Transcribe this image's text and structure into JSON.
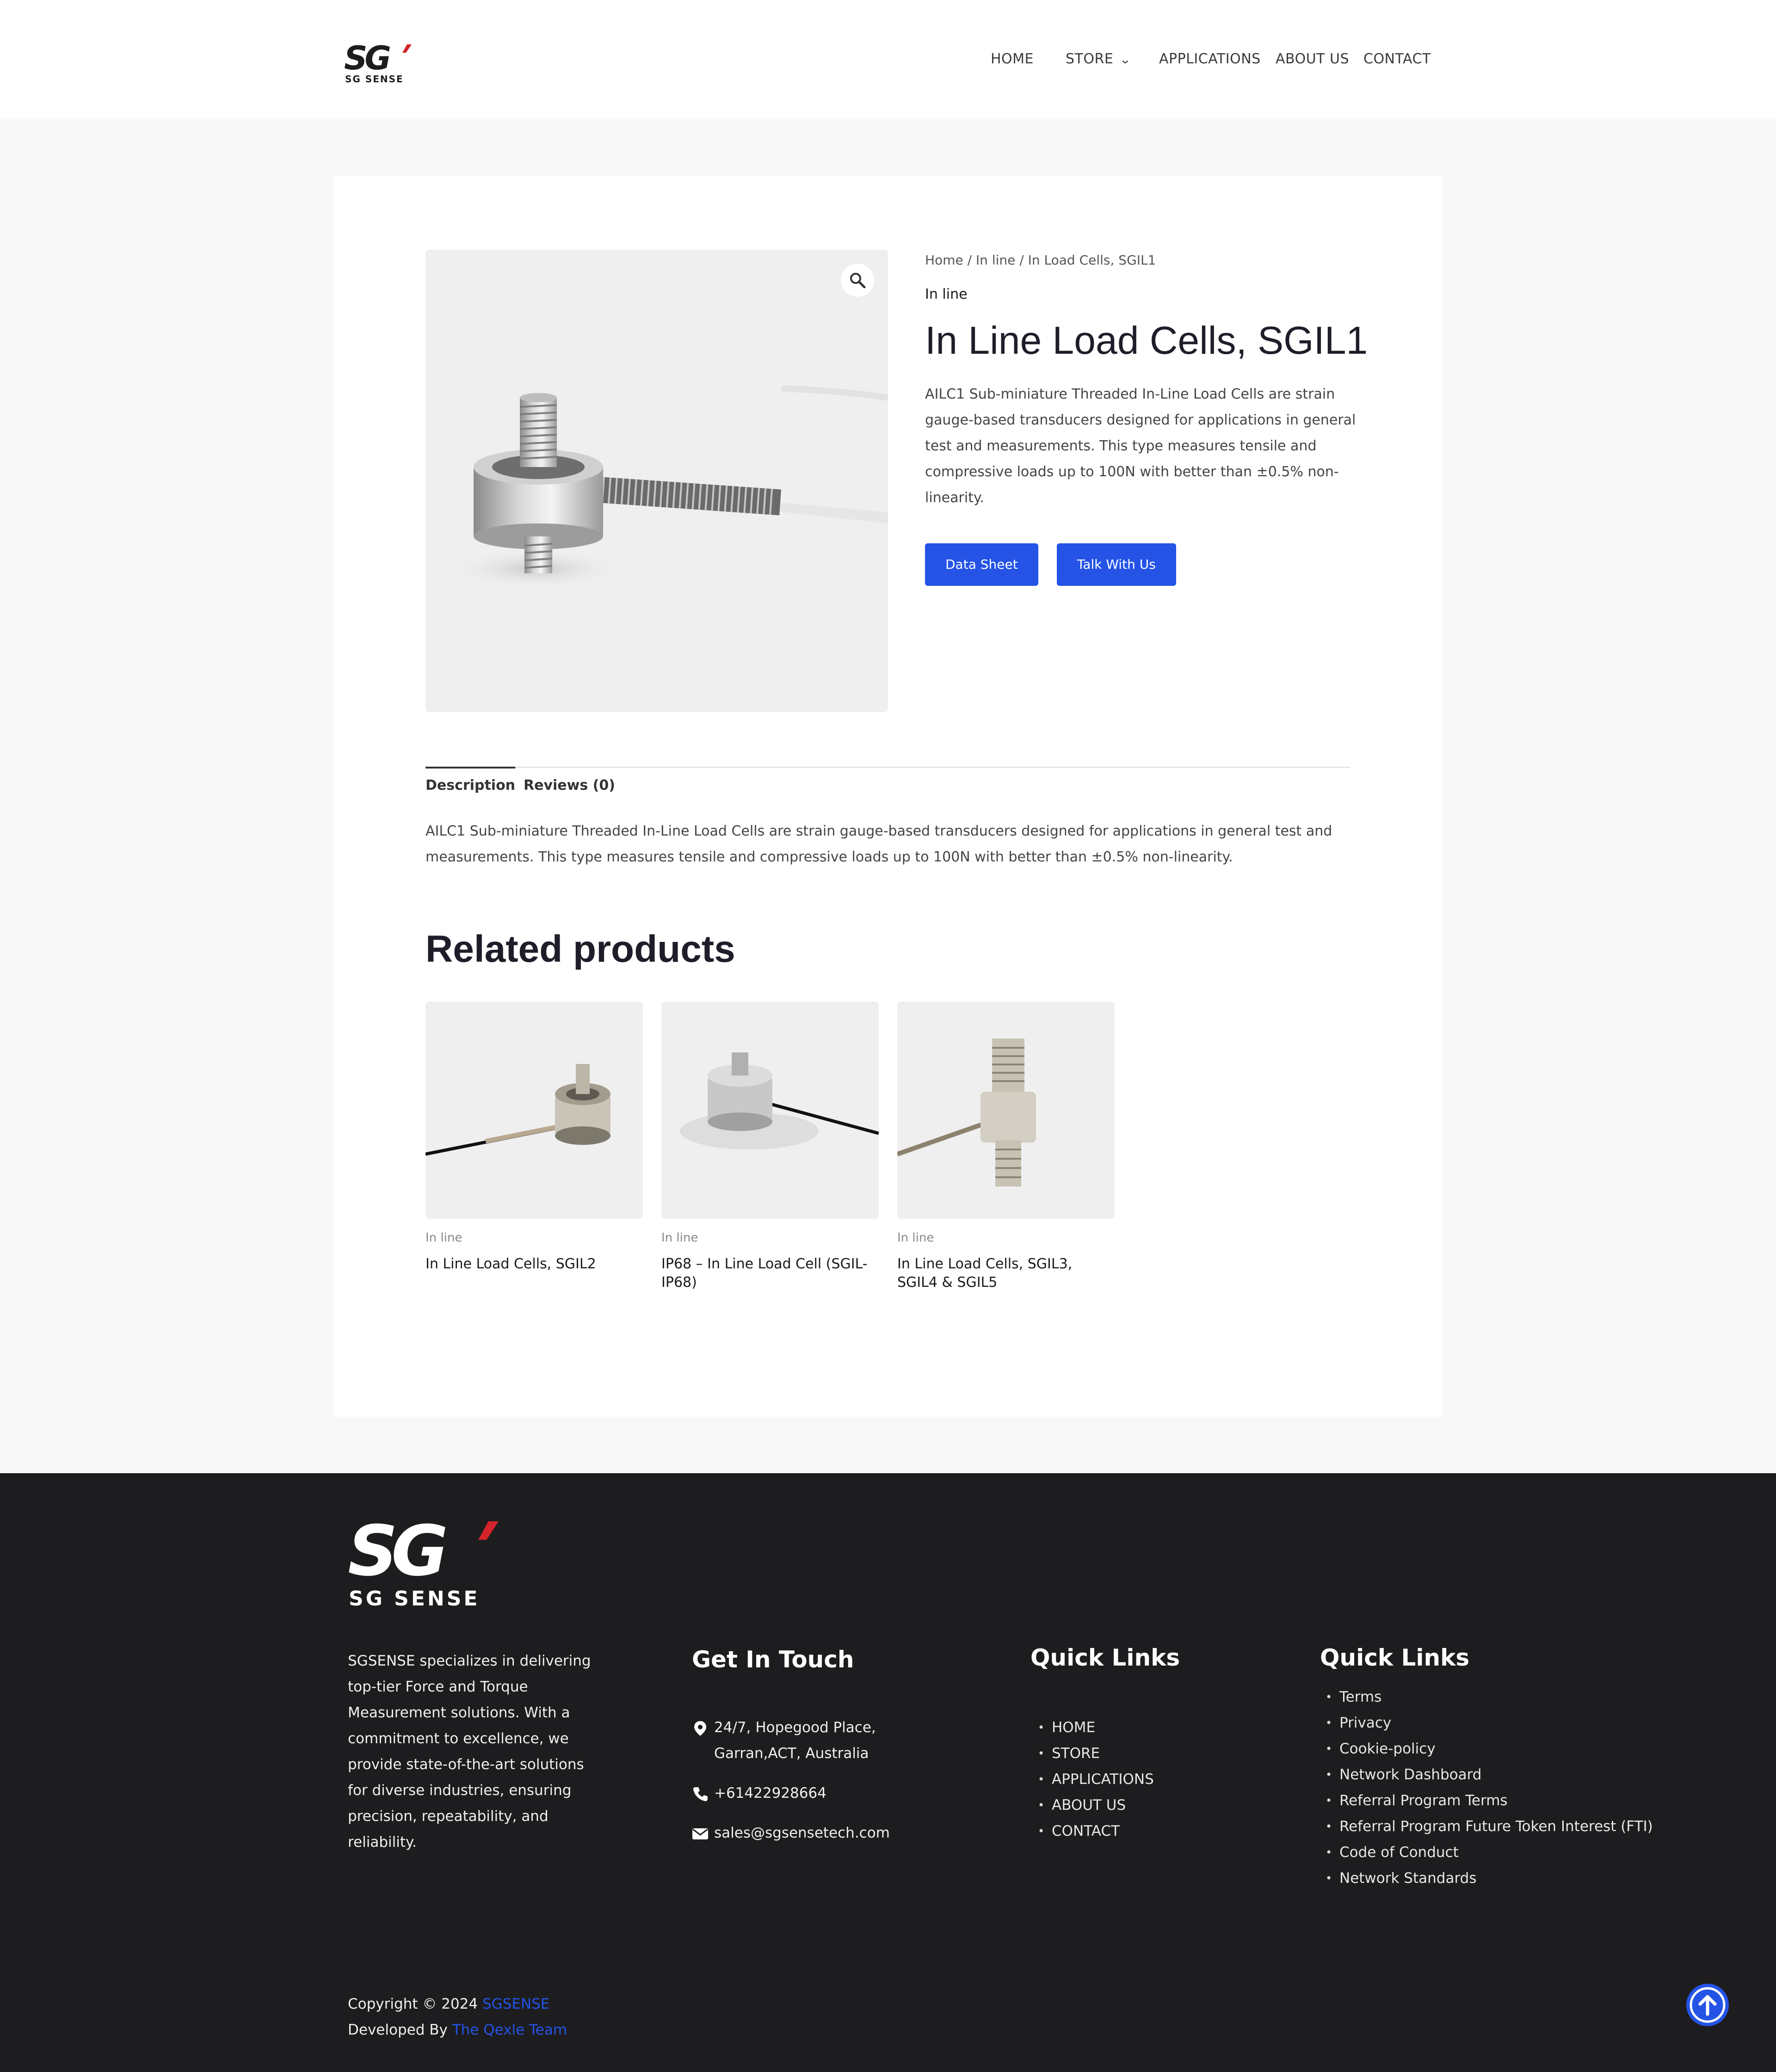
{
  "brand": {
    "logo_letters": "SG",
    "logo_text": "SG SENSE"
  },
  "nav": {
    "items": [
      "HOME",
      "STORE",
      "APPLICATIONS",
      "ABOUT US",
      "CONTACT"
    ]
  },
  "product": {
    "breadcrumb": {
      "home": "Home",
      "sep1": " / ",
      "category": "In line",
      "sep2": " / ",
      "current": "In Load Cells, SGIL1"
    },
    "category": "In line",
    "title": "In Line Load Cells, SGIL1",
    "short_description": "AILC1 Sub-miniature Threaded In-Line Load Cells are strain gauge-based transducers designed for applications in general test and measurements. This type measures tensile and compressive loads up to 100N with better than ±0.5% non-linearity.",
    "buttons": {
      "datasheet": "Data Sheet",
      "talk": "Talk With Us"
    }
  },
  "tabs": {
    "description": "Description",
    "reviews": "Reviews (0)"
  },
  "description_text": "AILC1 Sub-miniature Threaded In-Line Load Cells are strain gauge-based transducers designed for applications in general test and measurements. This type measures tensile and compressive loads up to 100N with better than ±0.5% non-linearity.",
  "related": {
    "title": "Related products",
    "items": [
      {
        "category": "In line",
        "name": "In Line Load Cells, SGIL2"
      },
      {
        "category": "In line",
        "name": "IP68 – In Line Load Cell (SGIL-IP68)"
      },
      {
        "category": "In line",
        "name": "In Line Load Cells, SGIL3, SGIL4 & SGIL5"
      }
    ]
  },
  "footer": {
    "about": "SGSENSE specializes in delivering top-tier Force and Torque Measurement solutions. With a commitment to excellence, we provide state-of-the-art solutions for diverse industries, ensuring precision, repeatability, and reliability.",
    "get_in_touch": {
      "title": "Get In Touch",
      "address_line1": "24/7, Hopegood Place,",
      "address_line2": "Garran,ACT, Australia",
      "phone": "+61422928664",
      "email": "sales@sgsensetech.com"
    },
    "quick_links_1": {
      "title": "Quick Links",
      "items": [
        "HOME",
        "STORE",
        "APPLICATIONS",
        "ABOUT US",
        "CONTACT"
      ]
    },
    "quick_links_2": {
      "title": "Quick Links",
      "items": [
        "Terms",
        "Privacy",
        "Cookie-policy",
        "Network Dashboard",
        "Referral Program Terms",
        "Referral Program Future Token Interest (FTI)",
        "Code of Conduct",
        "Network Standards"
      ]
    },
    "copyright_prefix": "Copyright © 2024 ",
    "copyright_brand": "SGSENSE",
    "developed_prefix": "Developed By ",
    "developed_by": "The Qexle Team"
  },
  "colors": {
    "accent": "#2453e6",
    "footer_bg": "#1d1d1f",
    "page_bg": "#f8f8f8",
    "logo_red": "#d4242b"
  }
}
